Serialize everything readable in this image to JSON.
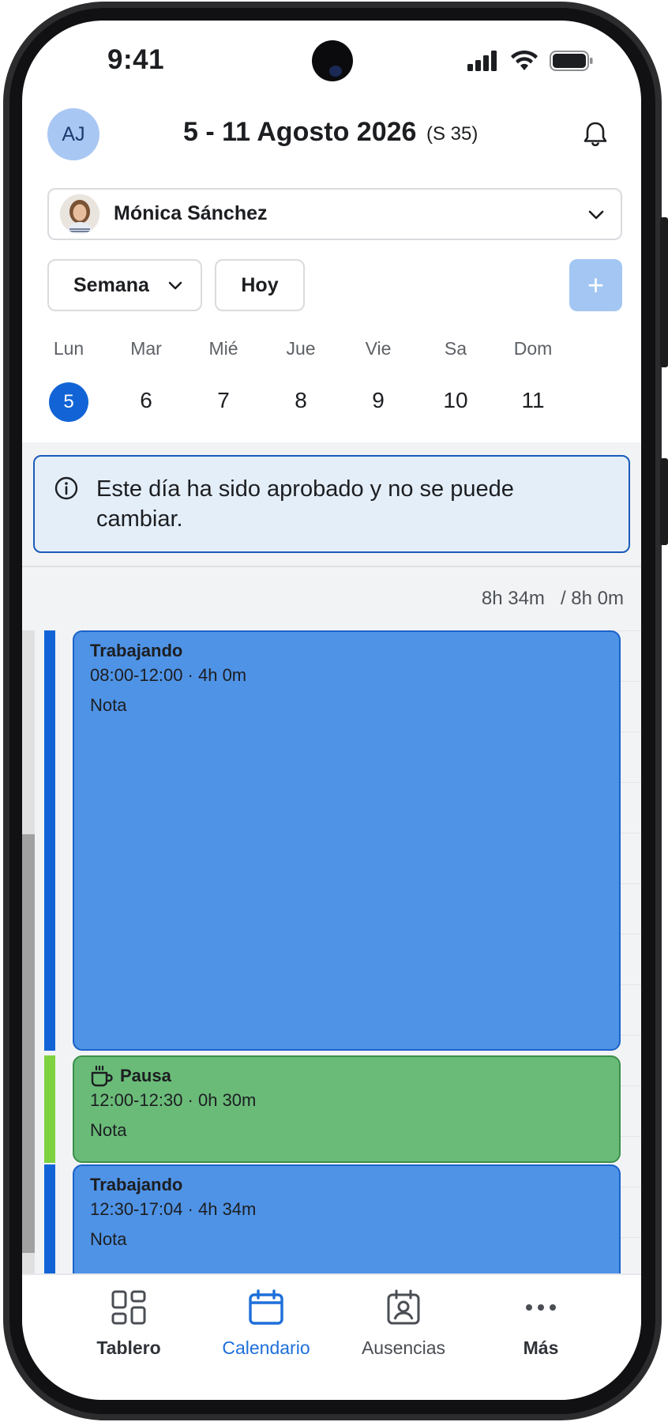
{
  "status_bar": {
    "time": "9:41"
  },
  "header": {
    "avatar_initials": "AJ",
    "title": "5 - 11 Agosto 2026",
    "week_label": "(S 35)"
  },
  "employee_select": {
    "name": "Mónica Sánchez"
  },
  "controls": {
    "view_label": "Semana",
    "today_label": "Hoy",
    "add_label": "+"
  },
  "week": {
    "selected_index": 0,
    "days": [
      {
        "name": "Lun",
        "num": "5"
      },
      {
        "name": "Mar",
        "num": "6"
      },
      {
        "name": "Mié",
        "num": "7"
      },
      {
        "name": "Jue",
        "num": "8"
      },
      {
        "name": "Vie",
        "num": "9"
      },
      {
        "name": "Sa",
        "num": "10"
      },
      {
        "name": "Dom",
        "num": "11"
      }
    ]
  },
  "notice": {
    "text": "Este día ha sido aprobado y no se puede cambiar."
  },
  "totals": {
    "worked": "8h 34m",
    "target": "/ 8h 0m"
  },
  "events": [
    {
      "type": "work",
      "title": "Trabajando",
      "time": "08:00-12:00 · 4h 0m",
      "note": "Nota"
    },
    {
      "type": "break",
      "title": "Pausa",
      "time": "12:00-12:30 · 0h 30m",
      "note": "Nota"
    },
    {
      "type": "work",
      "title": "Trabajando",
      "time": "12:30-17:04 · 4h 34m",
      "note": "Nota"
    }
  ],
  "colors": {
    "accent": "#1264d6",
    "work": "#4f93e6",
    "work_strip": "#1264d6",
    "break": "#6abb78",
    "break_strip": "#7ed23f"
  },
  "bottom_nav": [
    {
      "label": "Tablero",
      "icon": "dashboard-icon"
    },
    {
      "label": "Calendario",
      "icon": "calendar-icon",
      "active": true
    },
    {
      "label": "Ausencias",
      "icon": "absences-icon"
    },
    {
      "label": "Más",
      "icon": "more-icon"
    }
  ]
}
